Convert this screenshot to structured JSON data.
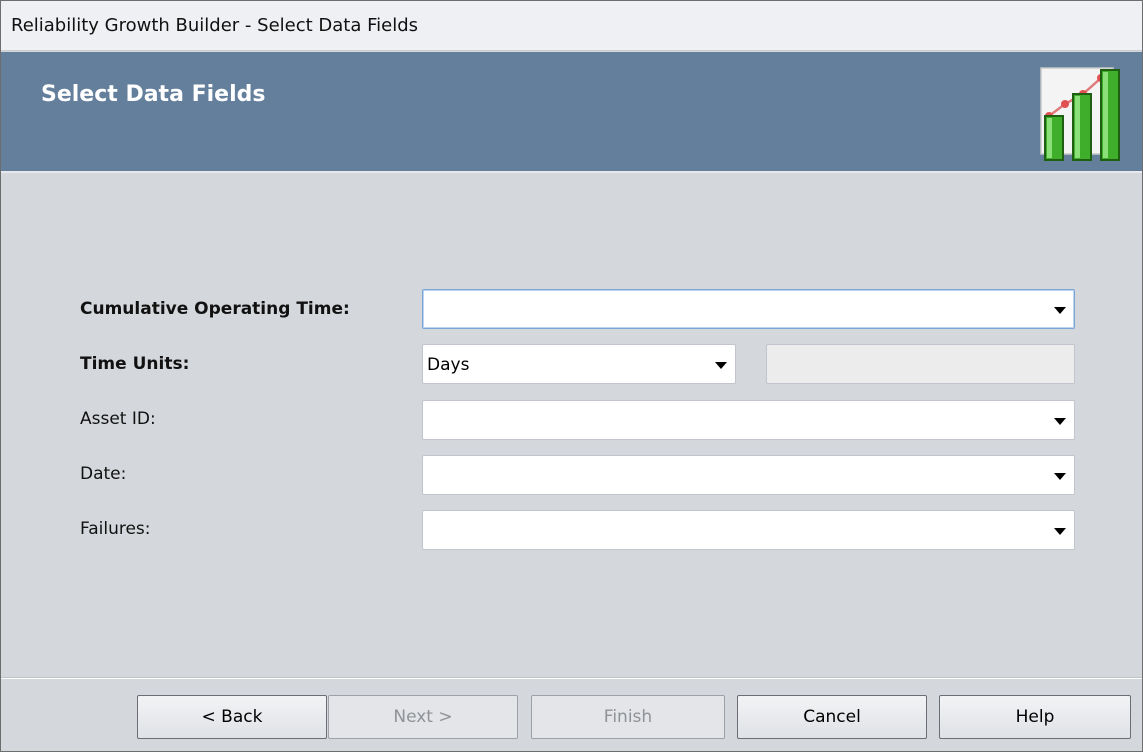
{
  "window": {
    "title": "Reliability Growth Builder - Select Data Fields"
  },
  "header": {
    "title": "Select Data Fields",
    "icon": "bar-chart-icon"
  },
  "form": {
    "cumulative_operating_time": {
      "label": "Cumulative Operating Time:",
      "value": ""
    },
    "time_units": {
      "label": "Time Units:",
      "value": "Days",
      "extra_value": ""
    },
    "asset_id": {
      "label": "Asset ID:",
      "value": ""
    },
    "date": {
      "label": "Date:",
      "value": ""
    },
    "failures": {
      "label": "Failures:",
      "value": ""
    }
  },
  "buttons": {
    "back": "< Back",
    "next": "Next >",
    "finish": "Finish",
    "cancel": "Cancel",
    "help": "Help"
  },
  "colors": {
    "header_bg": "#637f9c",
    "body_bg": "#d4d7db",
    "bar_green": "#3fae2a"
  }
}
